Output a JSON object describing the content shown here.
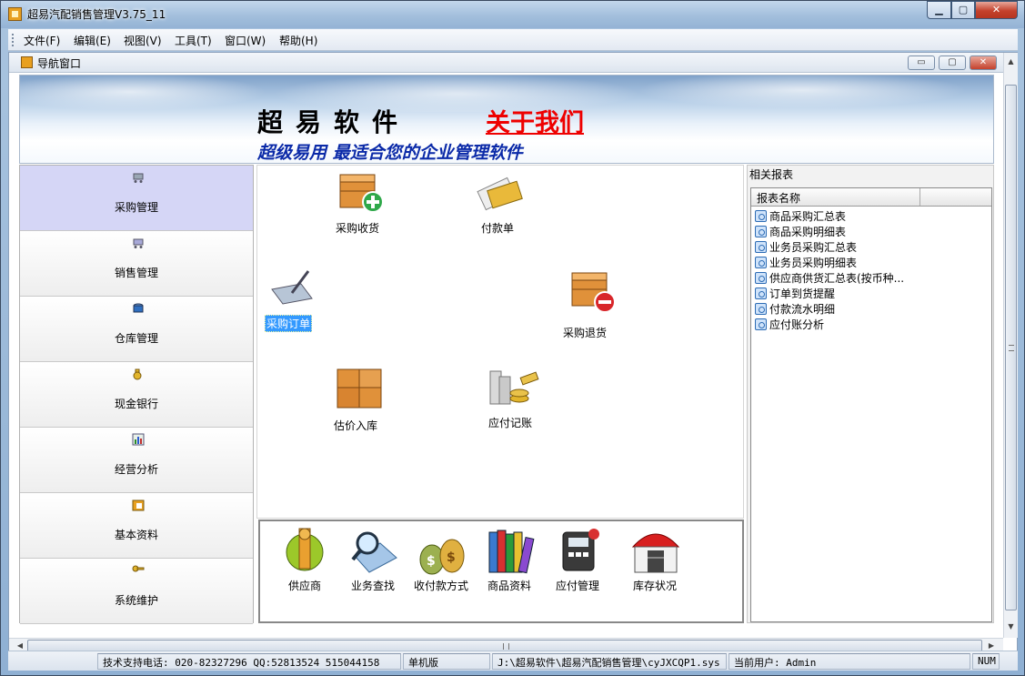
{
  "window": {
    "title": "超易汽配销售管理V3.75_11",
    "min": "▁",
    "max": "▢",
    "close": "✕"
  },
  "menu": [
    "文件(F)",
    "编辑(E)",
    "视图(V)",
    "工具(T)",
    "窗口(W)",
    "帮助(H)"
  ],
  "child": {
    "title": "导航窗口",
    "min": "▭",
    "max": "▢",
    "close": "✕"
  },
  "banner": {
    "brand": "超易软件",
    "about": "关于我们",
    "slogan": "超级易用 最适合您的企业管理软件"
  },
  "categories": [
    {
      "label": "采购管理",
      "icon": "cart-icon",
      "active": true
    },
    {
      "label": "销售管理",
      "icon": "cart-icon",
      "active": false
    },
    {
      "label": "仓库管理",
      "icon": "warehouse-icon",
      "active": false
    },
    {
      "label": "现金银行",
      "icon": "moneybag-icon",
      "active": false
    },
    {
      "label": "经营分析",
      "icon": "chart-icon",
      "active": false
    },
    {
      "label": "基本资料",
      "icon": "folder-icon",
      "active": false
    },
    {
      "label": "系统维护",
      "icon": "key-icon",
      "active": false
    }
  ],
  "tiles": {
    "purchase_receive": "采购收货",
    "payment": "付款单",
    "purchase_order": "采购订单",
    "purchase_return": "采购退货",
    "estimate_in": "估价入库",
    "payable_record": "应付记账"
  },
  "quickbar": [
    "供应商",
    "业务查找",
    "收付款方式",
    "商品资料",
    "应付管理",
    "库存状况"
  ],
  "reports": {
    "title": "相关报表",
    "column": "报表名称",
    "items": [
      "商品采购汇总表",
      "商品采购明细表",
      "业务员采购汇总表",
      "业务员采购明细表",
      "供应商供货汇总表(按币种...",
      "订单到货提醒",
      "付款流水明细",
      "应付账分析"
    ]
  },
  "status": {
    "support": "技术支持电话: 020-82327296 QQ:52813524 515044158",
    "mode": "单机版",
    "path": "J:\\超易软件\\超易汽配销售管理\\cyJXCQP1.sys",
    "user": "当前用户: Admin",
    "num": "NUM"
  },
  "colors": {
    "accent_link": "#ee0000",
    "slogan": "#0b2aa8",
    "active_category": "#d5d6f6",
    "selection": "#3399ff"
  }
}
